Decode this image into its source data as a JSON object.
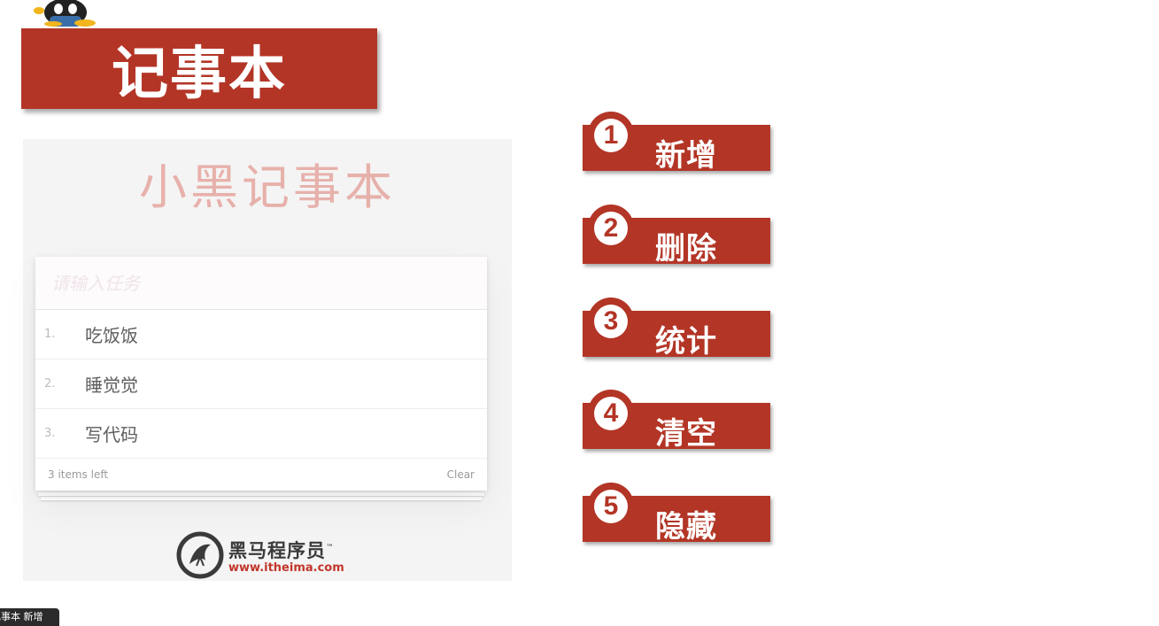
{
  "slide": {
    "title": "记事本"
  },
  "demo": {
    "heading": "小黑记事本",
    "input_placeholder": "请输入任务",
    "todos": [
      {
        "index": "1.",
        "text": "吃饭饭"
      },
      {
        "index": "2.",
        "text": "睡觉觉"
      },
      {
        "index": "3.",
        "text": "写代码"
      }
    ],
    "footer": {
      "items_left": "3 items left",
      "clear_label": "Clear"
    },
    "logo": {
      "name": "黑马程序员",
      "trademark": "™",
      "url": "www.itheima.com"
    }
  },
  "features": [
    {
      "number": "1",
      "label": "新增"
    },
    {
      "number": "2",
      "label": "删除"
    },
    {
      "number": "3",
      "label": "统计"
    },
    {
      "number": "4",
      "label": "清空"
    },
    {
      "number": "5",
      "label": "隐藏"
    }
  ],
  "tooltip": {
    "text": "记事本 新增"
  },
  "colors": {
    "accent": "#b33526",
    "heading_pink": "#e7b1ab"
  }
}
